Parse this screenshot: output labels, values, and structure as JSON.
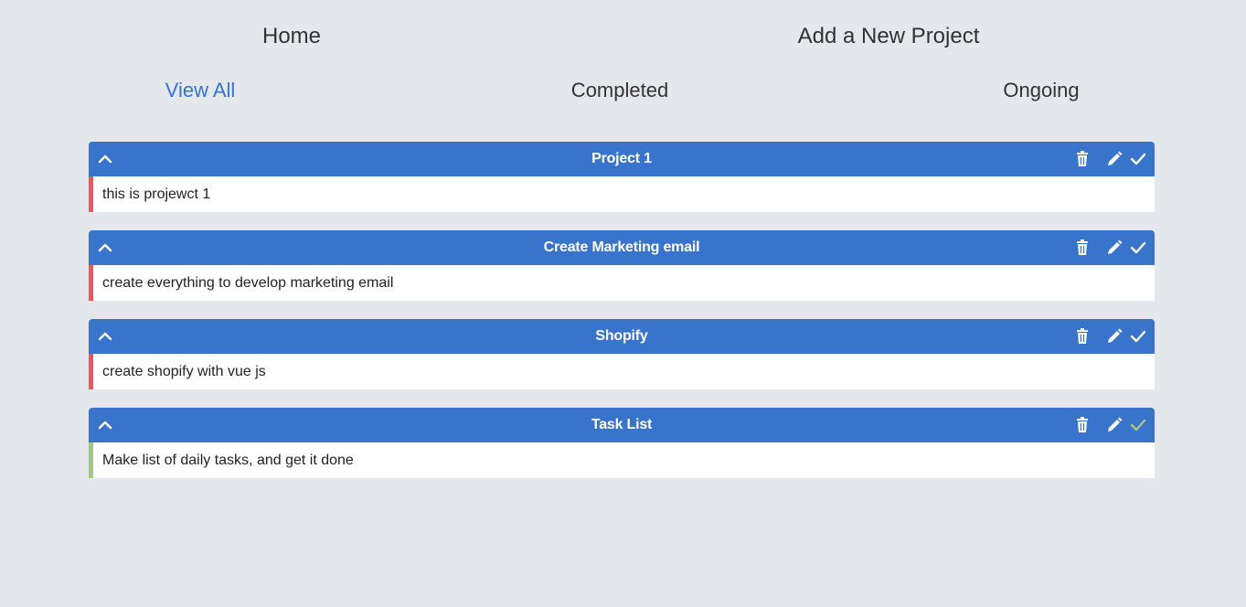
{
  "nav": {
    "home": "Home",
    "add_project": "Add a New Project"
  },
  "filters": {
    "view_all": "View All",
    "completed": "Completed",
    "ongoing": "Ongoing",
    "active": "view_all"
  },
  "colors": {
    "page_background": "#e4e7eb",
    "header_blue": "#3874cb",
    "ongoing_accent": "#f5515f",
    "completed_accent": "#a4c97b",
    "active_filter": "#3874cb"
  },
  "projects": [
    {
      "title": "Project 1",
      "details": "this is projewct 1",
      "completed": false,
      "icons": [
        "chevron-up-icon",
        "trash-icon",
        "pencil-icon",
        "check-icon"
      ]
    },
    {
      "title": "Create Marketing email",
      "details": "create everything to develop marketing email",
      "completed": false,
      "icons": [
        "chevron-up-icon",
        "trash-icon",
        "pencil-icon",
        "check-icon"
      ]
    },
    {
      "title": "Shopify",
      "details": "create shopify with vue js",
      "completed": false,
      "icons": [
        "chevron-up-icon",
        "trash-icon",
        "pencil-icon",
        "check-icon"
      ]
    },
    {
      "title": "Task List",
      "details": "Make list of daily tasks, and get it done",
      "completed": true,
      "icons": [
        "chevron-up-icon",
        "trash-icon",
        "pencil-icon",
        "check-icon"
      ]
    }
  ]
}
